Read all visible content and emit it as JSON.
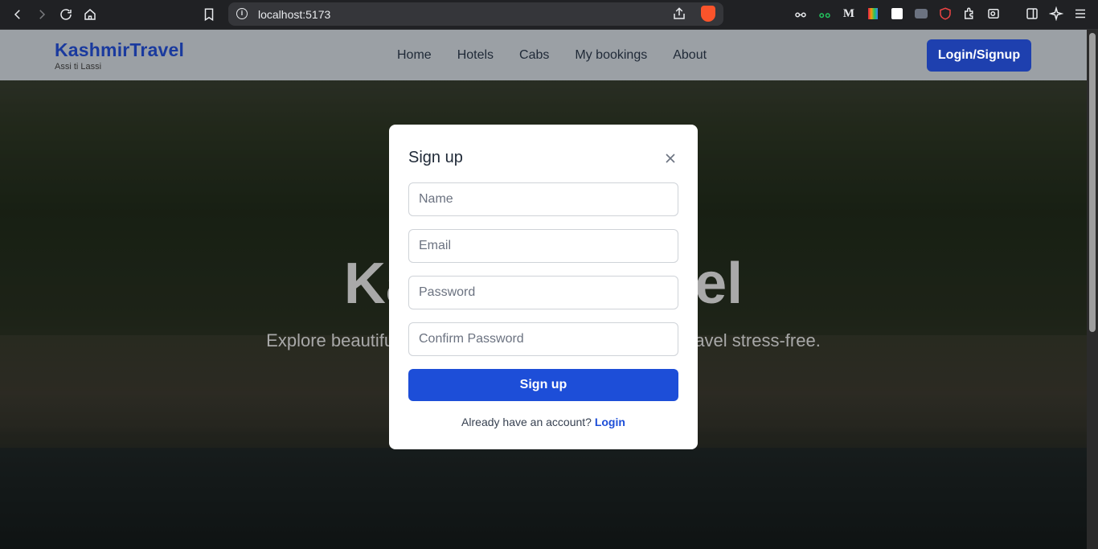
{
  "browser": {
    "url": "localhost:5173"
  },
  "navbar": {
    "brand_title": "KashmirTravel",
    "brand_subtitle": "Assi ti Lassi",
    "menu": [
      "Home",
      "Hotels",
      "Cabs",
      "My bookings",
      "About"
    ],
    "login_label": "Login/Signup"
  },
  "hero": {
    "title": "KashmirTravel",
    "subtitle": "Explore beautiful Kashmir — book hotels & cabs and travel stress-free."
  },
  "modal": {
    "title": "Sign up",
    "name_placeholder": "Name",
    "email_placeholder": "Email",
    "password_placeholder": "Password",
    "confirm_placeholder": "Confirm Password",
    "submit_label": "Sign up",
    "switch_prompt": "Already have an account? ",
    "switch_link": "Login"
  },
  "colors": {
    "brand": "#1a3a9e",
    "primary_button": "#1d4ed8"
  }
}
